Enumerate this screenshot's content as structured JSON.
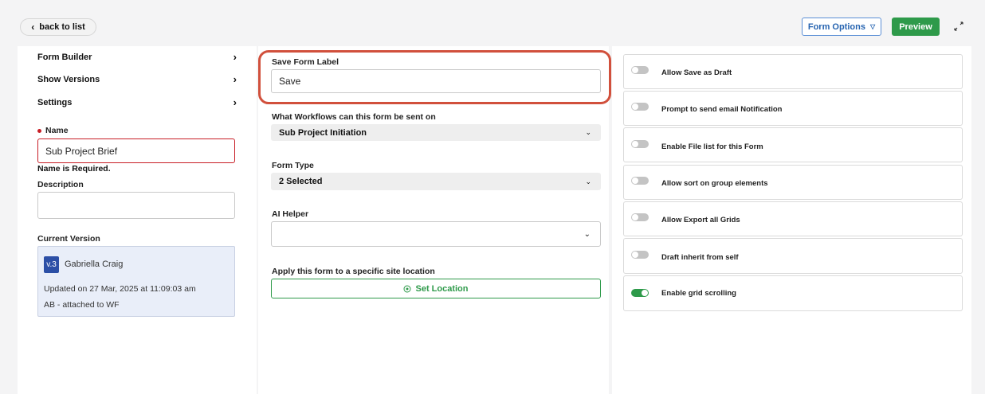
{
  "topbar": {
    "back_label": "back to list",
    "form_options_label": "Form Options",
    "preview_label": "Preview"
  },
  "sidebar": {
    "items": [
      {
        "label": "Form Builder"
      },
      {
        "label": "Show Versions"
      },
      {
        "label": "Settings"
      }
    ],
    "name_label": "Name",
    "name_value": "Sub Project Brief",
    "name_error": "Name is Required.",
    "description_label": "Description",
    "description_value": "",
    "current_version_label": "Current Version",
    "version": {
      "badge": "v.3",
      "author": "Gabriella Craig",
      "updated": "Updated on 27 Mar, 2025 at 11:09:03 am",
      "note": "AB - attached to WF"
    }
  },
  "main": {
    "save_form_label_title": "Save Form Label",
    "save_form_label_value": "Save",
    "workflows_label": "What Workflows can this form be sent on",
    "workflows_value": "Sub Project Initiation",
    "form_type_label": "Form Type",
    "form_type_value": "2 Selected",
    "ai_helper_label": "AI Helper",
    "ai_helper_value": "",
    "location_label": "Apply this form to a specific site location",
    "set_location_label": "Set Location"
  },
  "options": [
    {
      "label": "Allow Save as Draft",
      "enabled": false
    },
    {
      "label": "Prompt to send email Notification",
      "enabled": false
    },
    {
      "label": "Enable File list for this Form",
      "enabled": false
    },
    {
      "label": "Allow sort on group elements",
      "enabled": false
    },
    {
      "label": "Allow Export all Grids",
      "enabled": false
    },
    {
      "label": "Draft inherit from self",
      "enabled": false
    },
    {
      "label": "Enable grid scrolling",
      "enabled": true
    }
  ],
  "colors": {
    "accent_green": "#2e9a4a",
    "accent_blue": "#2563b0",
    "error_red": "#c81d25",
    "highlight": "#d1503c"
  }
}
